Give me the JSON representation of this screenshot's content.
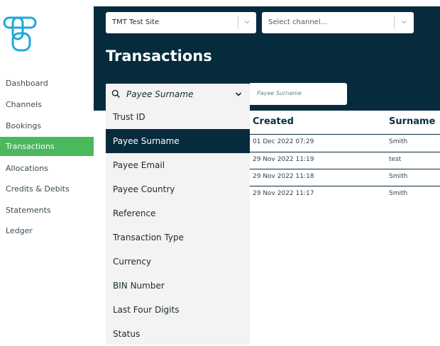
{
  "sidebar": {
    "items": [
      {
        "label": "Dashboard"
      },
      {
        "label": "Channels"
      },
      {
        "label": "Bookings"
      },
      {
        "label": "Transactions",
        "active": true
      },
      {
        "label": "Allocations"
      },
      {
        "label": "Credits & Debits"
      },
      {
        "label": "Statements"
      },
      {
        "label": "Ledger"
      }
    ]
  },
  "header": {
    "site_select": "TMT Test Site",
    "channel_select_placeholder": "Select channel...",
    "title": "Transactions"
  },
  "filter": {
    "field_value": "Payee Surname",
    "input_placeholder": "Payee Surname",
    "options": [
      "Trust ID",
      "Payee Surname",
      "Payee Email",
      "Payee Country",
      "Reference",
      "Transaction Type",
      "Currency",
      "BIN Number",
      "Last Four Digits",
      "Status"
    ],
    "selected_option": "Payee Surname"
  },
  "table": {
    "headers": [
      "Created",
      "Surname"
    ],
    "rows": [
      {
        "created": "01 Dec 2022 07:29",
        "surname": "Smith"
      },
      {
        "created": "29 Nov 2022 11:19",
        "surname": "test"
      },
      {
        "created": "29 Nov 2022 11:18",
        "surname": "Smith"
      },
      {
        "created": "29 Nov 2022 11:17",
        "surname": "Smith"
      }
    ]
  },
  "colors": {
    "brand_dark": "#062b3d",
    "active_green": "#4cb85c",
    "logo_blue": "#1fa7d9"
  },
  "icons": [
    "logo-icon",
    "search-icon",
    "chevron-down-icon"
  ]
}
